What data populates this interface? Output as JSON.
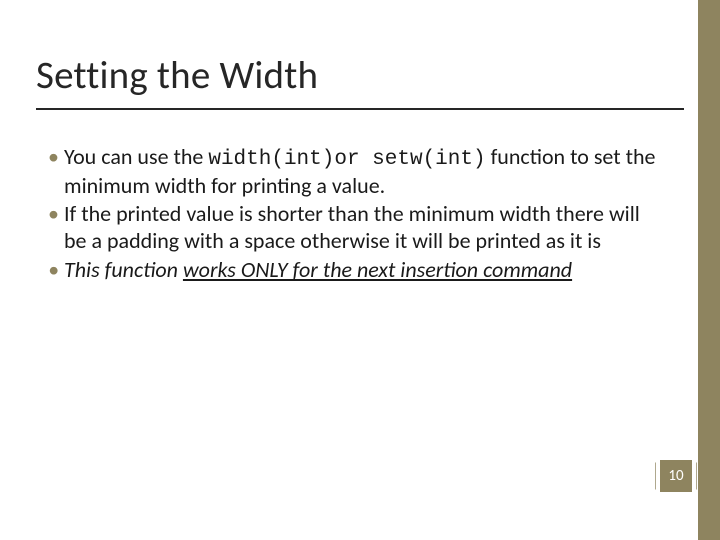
{
  "title": "Setting the Width",
  "bullets": {
    "b1_pre": "You can use the ",
    "b1_code": "width(int)or setw(int)",
    "b1_post": " function to set the minimum width for printing a value.",
    "b2": "If the printed value is shorter than the minimum width there will be a padding with a space otherwise it will be printed as it is",
    "b3_lead": " This function ",
    "b3_underlined": "works ONLY for the next insertion command"
  },
  "page_number": "10"
}
